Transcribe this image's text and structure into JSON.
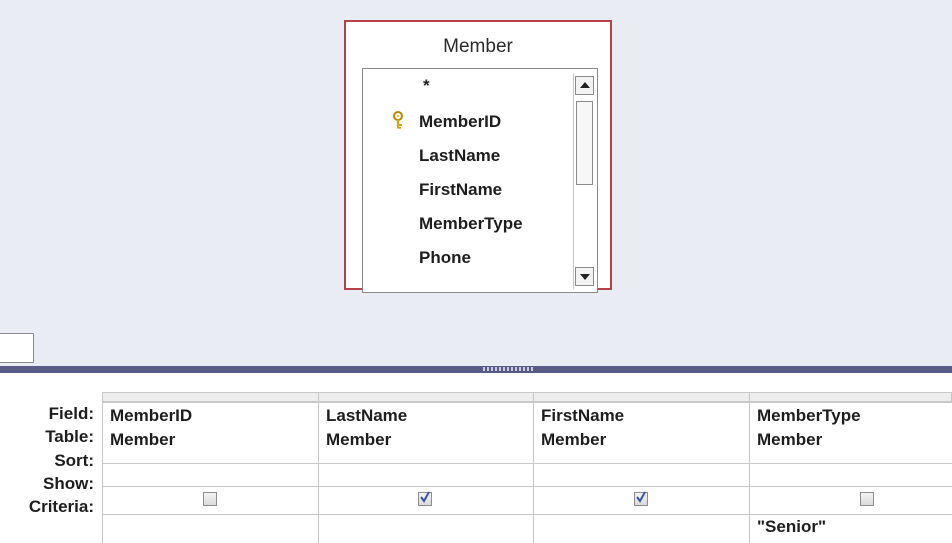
{
  "table_box": {
    "title": "Member",
    "fields": [
      {
        "name": "*",
        "key": false
      },
      {
        "name": "MemberID",
        "key": true
      },
      {
        "name": "LastName",
        "key": false
      },
      {
        "name": "FirstName",
        "key": false
      },
      {
        "name": "MemberType",
        "key": false
      },
      {
        "name": "Phone",
        "key": false
      }
    ],
    "scrollbar": {
      "up_icon": "scroll-up-arrow-icon",
      "down_icon": "scroll-down-arrow-icon"
    }
  },
  "grid": {
    "row_labels": {
      "field": "Field:",
      "table": "Table:",
      "sort": "Sort:",
      "show": "Show:",
      "criteria": "Criteria:"
    },
    "columns": [
      {
        "field": "MemberID",
        "table": "Member",
        "sort": "",
        "show": false,
        "criteria": ""
      },
      {
        "field": "LastName",
        "table": "Member",
        "sort": "",
        "show": true,
        "criteria": ""
      },
      {
        "field": "FirstName",
        "table": "Member",
        "sort": "",
        "show": true,
        "criteria": ""
      },
      {
        "field": "MemberType",
        "table": "Member",
        "sort": "",
        "show": false,
        "criteria": "\"Senior\""
      }
    ]
  },
  "colors": {
    "table_border": "#b5414a",
    "splitter": "#595a86",
    "upper_background": "#e9ecf2",
    "checkmark": "#3a56a8"
  }
}
